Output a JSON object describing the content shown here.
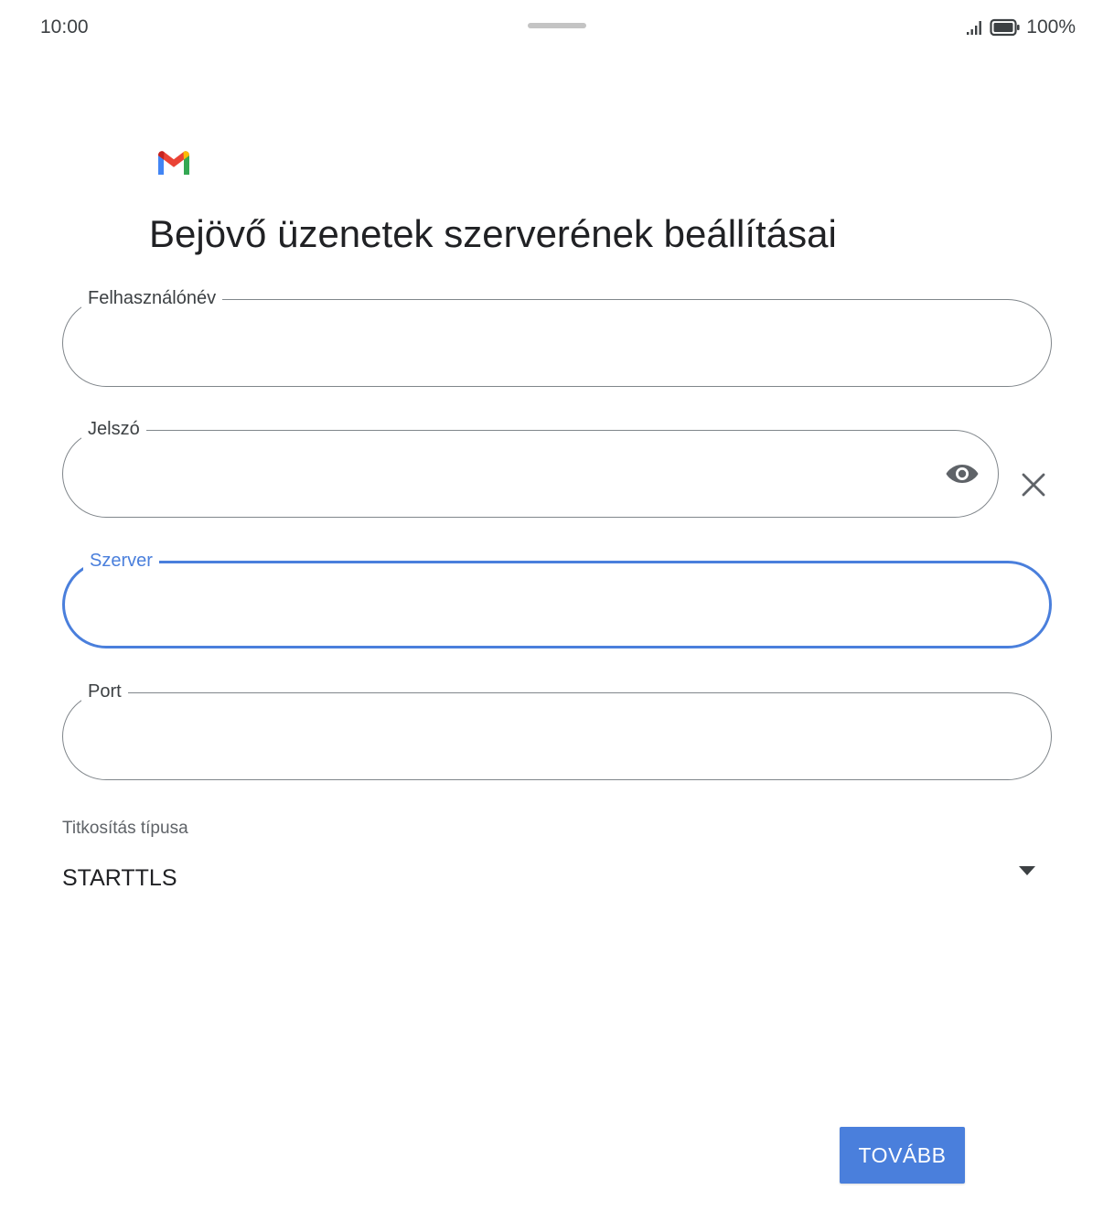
{
  "status_bar": {
    "time": "10:00",
    "battery": "100%",
    "icons": [
      "signal-icon",
      "battery-icon"
    ]
  },
  "app": {
    "logo": "gmail-logo",
    "title": "Bejövő üzenetek szerverének beállításai"
  },
  "form": {
    "username": {
      "label": "Felhasználónév",
      "value": ""
    },
    "password": {
      "label": "Jelszó",
      "value": "",
      "icons": [
        "eye-icon",
        "close-icon"
      ]
    },
    "server": {
      "label": "Szerver",
      "value": "",
      "focused": true
    },
    "port": {
      "label": "Port",
      "value": ""
    },
    "encryption": {
      "label": "Titkosítás típusa",
      "selected": "STARTTLS",
      "icon": "dropdown-arrow-icon"
    }
  },
  "actions": {
    "next_label": "TOVÁBB"
  },
  "colors": {
    "accent": "#4a7fdc",
    "outline": "#80868b",
    "text": "#202124"
  }
}
